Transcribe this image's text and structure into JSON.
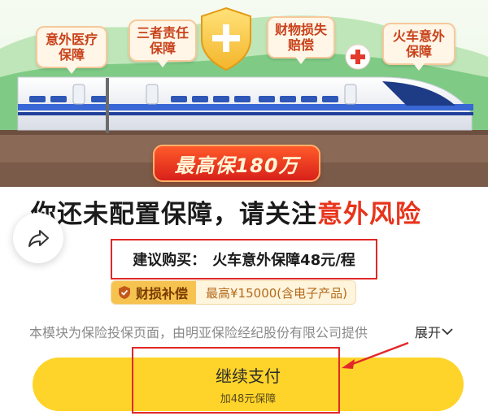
{
  "hero": {
    "bubbles": [
      "意外医疗保障",
      "三者责任保障",
      "财物损失赔偿",
      "火车意外保障"
    ],
    "max_coverage": "最高保180万",
    "colors": {
      "sky": "#e9f7e6",
      "hills": "#6fc27a",
      "train_accent": "#3a67d6",
      "banner": "#e23a1f"
    }
  },
  "headline": {
    "prefix": "你还未配置保障，请关注",
    "accent": "意外风险"
  },
  "share": {
    "icon": "share-icon"
  },
  "suggestion": {
    "label": "建议购买：",
    "value": "火车意外保障48元/程"
  },
  "benefit_tag": {
    "name": "财损补偿",
    "detail": "最高¥15000(含电子产品)",
    "icon": "shield-check-icon"
  },
  "disclaimer": {
    "text": "本模块为保险投保页面，由明亚保险经纪股份有限公司提供",
    "expand": "展开"
  },
  "pay_button": {
    "label": "继续支付",
    "sub": "加48元保障",
    "color": "#ffd42a"
  }
}
